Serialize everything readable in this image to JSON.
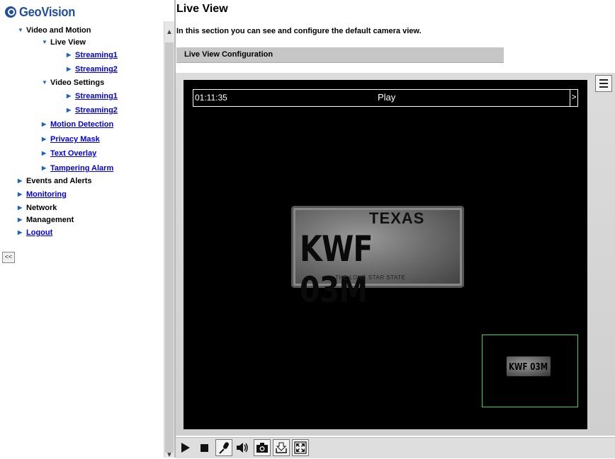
{
  "nav": {
    "logo": "GeoVision",
    "items": [
      {
        "label": "Video and Motion",
        "link": false,
        "level": 0
      },
      {
        "label": "Live View",
        "link": false,
        "level": 1
      },
      {
        "label": "Streaming1",
        "link": true,
        "level": 2
      },
      {
        "label": "Streaming2",
        "link": true,
        "level": 2
      },
      {
        "label": "Video Settings",
        "link": false,
        "level": 1
      },
      {
        "label": "Streaming1",
        "link": true,
        "level": 2
      },
      {
        "label": "Streaming2",
        "link": true,
        "level": 2
      },
      {
        "label": "Motion Detection",
        "link": true,
        "level": 1
      },
      {
        "label": "Privacy Mask",
        "link": true,
        "level": 1
      },
      {
        "label": "Text Overlay",
        "link": true,
        "level": 1
      },
      {
        "label": "Tampering Alarm",
        "link": true,
        "level": 1
      },
      {
        "label": "Events and Alerts",
        "link": false,
        "level": 0
      },
      {
        "label": "Monitoring",
        "link": true,
        "level": 0
      },
      {
        "label": "Network",
        "link": false,
        "level": 0
      },
      {
        "label": "Management",
        "link": false,
        "level": 0
      },
      {
        "label": "Logout",
        "link": true,
        "level": 0
      }
    ],
    "collapse_label": "<<"
  },
  "main": {
    "title": "Live View",
    "description": "In this section you can see and configure the default camera view.",
    "section_header": "Live View Configuration"
  },
  "video": {
    "time": "01:11:35",
    "state": "Play",
    "next_label": ">",
    "plate_state": "TEXAS",
    "plate_number": "KWF 03M",
    "plate_motto": "THE LONE STAR STATE",
    "pip_border_color": "#3ad34a"
  },
  "toolbar": {
    "buttons": [
      "play-icon",
      "stop-icon",
      "microphone-icon",
      "speaker-icon",
      "snapshot-icon",
      "download-icon",
      "fullscreen-icon"
    ]
  }
}
